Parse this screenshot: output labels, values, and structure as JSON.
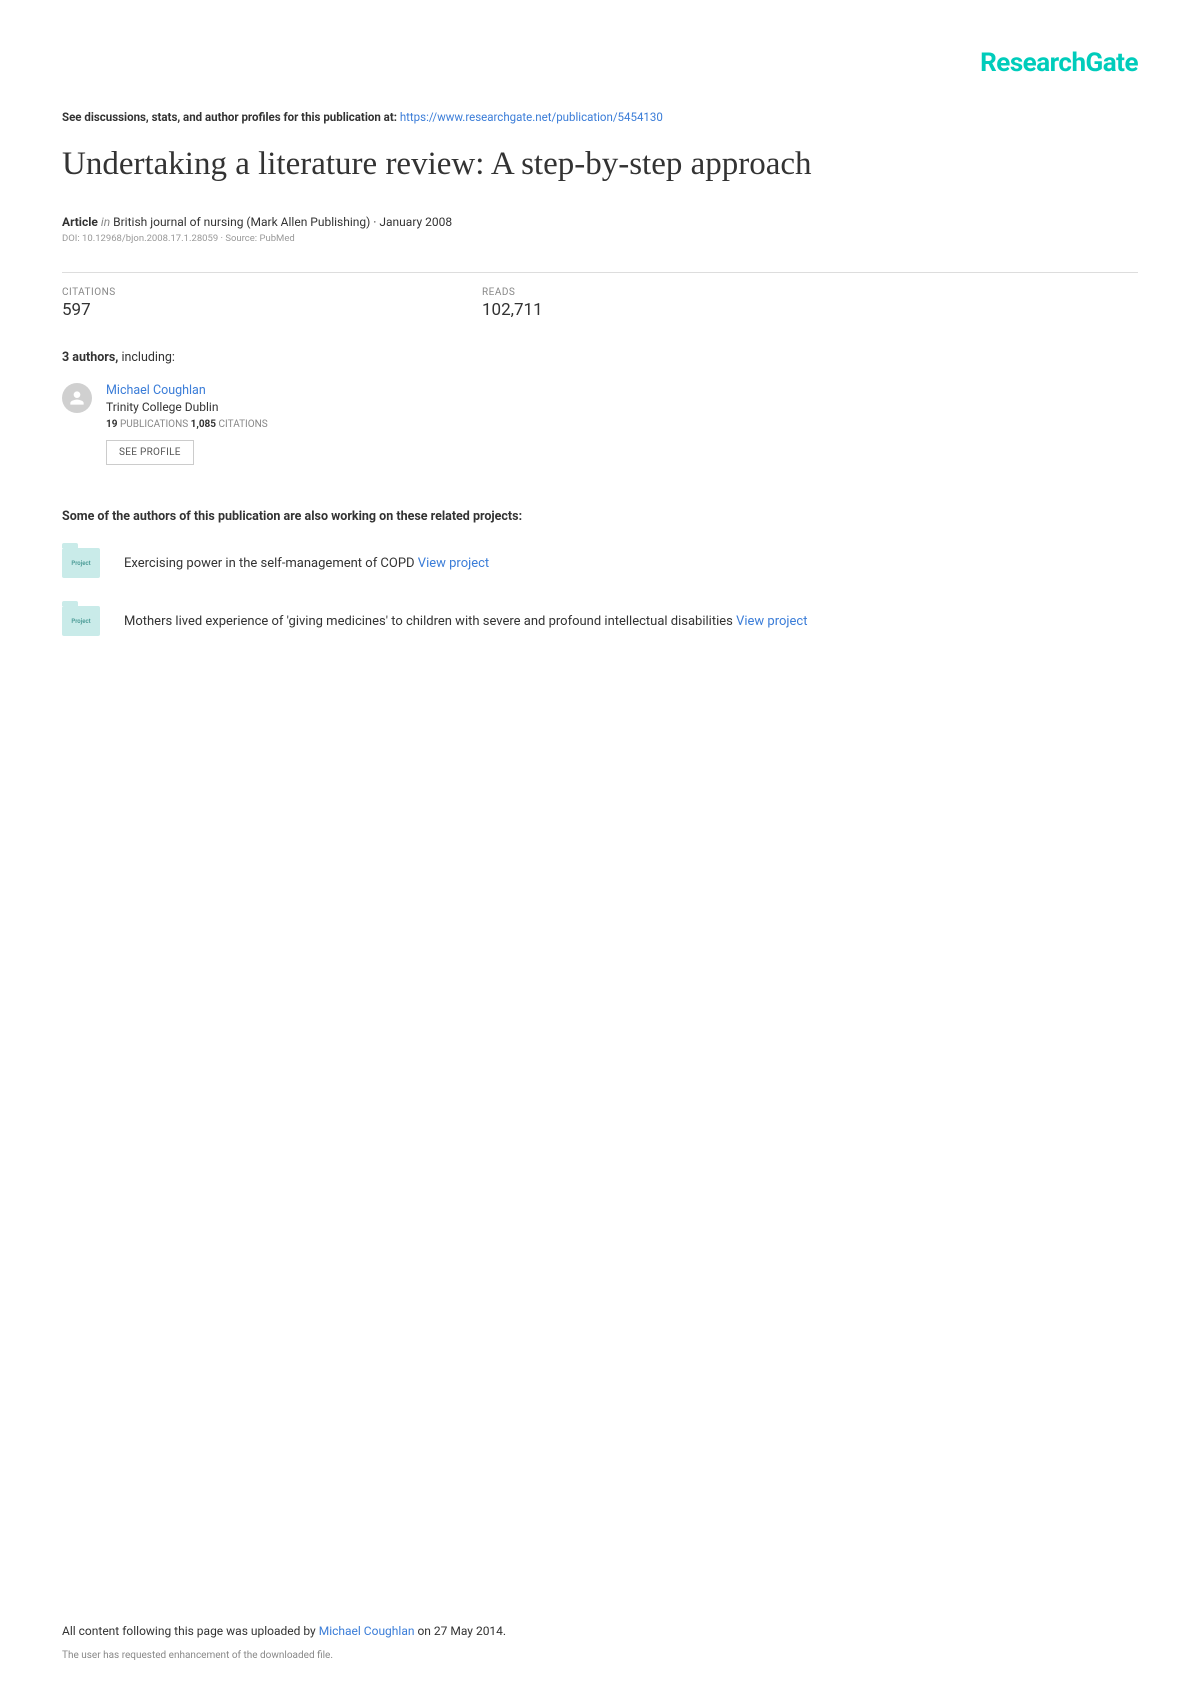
{
  "logo": "ResearchGate",
  "discussion": {
    "prefix": "See discussions, stats, and author profiles for this publication at: ",
    "url": "https://www.researchgate.net/publication/5454130"
  },
  "title": "Undertaking a literature review: A step-by-step approach",
  "meta": {
    "type": "Article",
    "italic_in": "in",
    "journal": " British journal of nursing (Mark Allen Publishing) · January 2008",
    "doi": "DOI: 10.12968/bjon.2008.17.1.28059 · Source: PubMed"
  },
  "stats": {
    "citations_label": "CITATIONS",
    "citations_value": "597",
    "reads_label": "READS",
    "reads_value": "102,711"
  },
  "authors": {
    "count_text": "3 authors,",
    "including_text": " including:",
    "author": {
      "name": "Michael Coughlan",
      "affiliation": "Trinity College Dublin",
      "publications_num": "19",
      "publications_label": " PUBLICATIONS   ",
      "citations_num": "1,085",
      "citations_label": " CITATIONS",
      "see_profile": "SEE PROFILE"
    }
  },
  "related": {
    "heading": "Some of the authors of this publication are also working on these related projects:",
    "icon_label": "Project",
    "projects": [
      {
        "text": "Exercising power in the self-management of COPD ",
        "link": "View project"
      },
      {
        "text": "Mothers lived experience of 'giving medicines' to children with severe and profound intellectual disabilities ",
        "link": "View project"
      }
    ]
  },
  "footer": {
    "line1_prefix": "All content following this page was uploaded by ",
    "line1_author": "Michael Coughlan",
    "line1_suffix": " on 27 May 2014.",
    "line2": "The user has requested enhancement of the downloaded file."
  }
}
